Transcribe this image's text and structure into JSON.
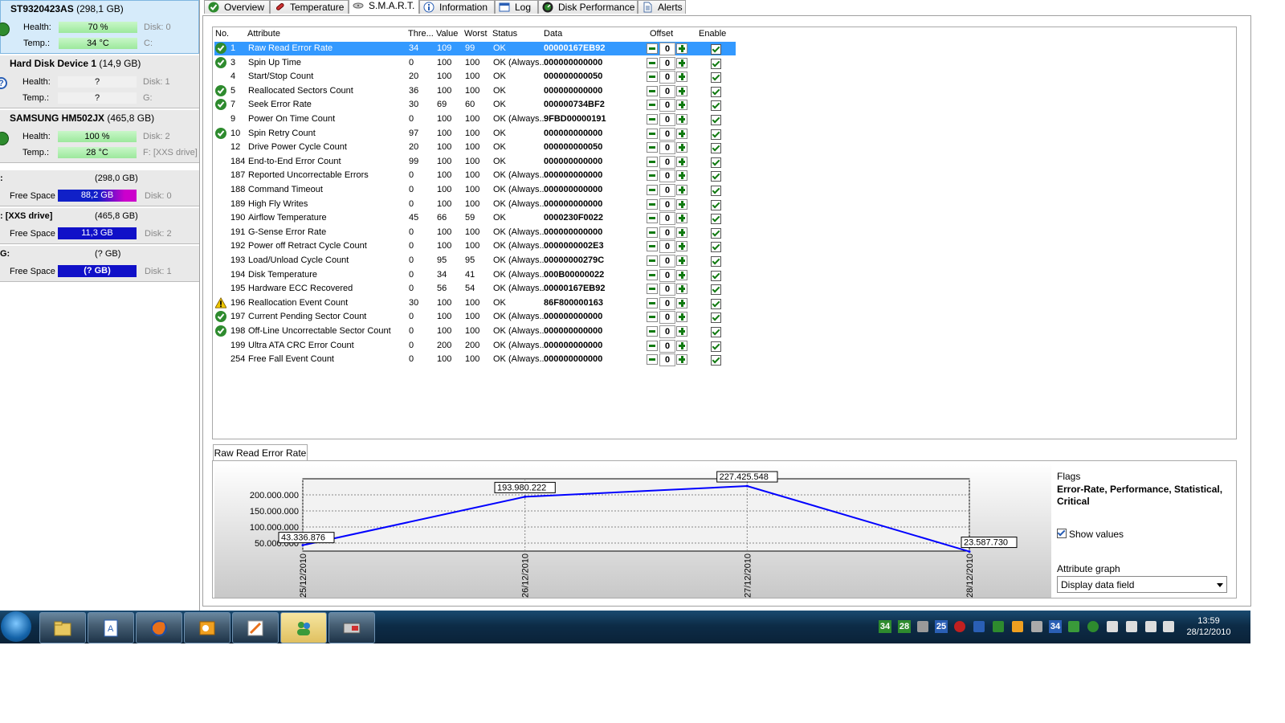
{
  "left_panel": {
    "disks": [
      {
        "name": "ST9320423AS",
        "size": "(298,1 GB)",
        "health_label": "Health:",
        "health": "70 %",
        "disk": "Disk: 0",
        "temp_label": "Temp.:",
        "temp": "34 °C",
        "drive": "C:"
      },
      {
        "name": "Hard Disk Device 1",
        "size": "(14,9 GB)",
        "health_label": "Health:",
        "health": "?",
        "disk": "Disk: 1",
        "temp_label": "Temp.:",
        "temp": "?",
        "drive": "G:"
      },
      {
        "name": "SAMSUNG HM502JX",
        "size": "(465,8 GB)",
        "health_label": "Health:",
        "health": "100 %",
        "disk": "Disk: 2",
        "temp_label": "Temp.:",
        "temp": "28 °C",
        "drive": "F: [XXS drive]"
      }
    ],
    "volumes": [
      {
        "name": ":",
        "size": "(298,0 GB)",
        "free_label": "Free Space",
        "free": "88,2 GB",
        "disk": "Disk: 0"
      },
      {
        "name": ": [XXS drive]",
        "size": "(465,8 GB)",
        "free_label": "Free Space",
        "free": "11,3 GB",
        "disk": "Disk: 2"
      },
      {
        "name": "G:",
        "size": "(? GB)",
        "free_label": "Free Space",
        "free": "(? GB)",
        "disk": "Disk: 1"
      }
    ]
  },
  "tabs": [
    "Overview",
    "Temperature",
    "S.M.A.R.T.",
    "Information",
    "Log",
    "Disk Performance",
    "Alerts"
  ],
  "grid": {
    "headers": {
      "no": "No.",
      "attribute": "Attribute",
      "threshold": "Thre...",
      "value": "Value",
      "worst": "Worst",
      "status": "Status",
      "data": "Data",
      "offset": "Offset",
      "enable": "Enable"
    },
    "rows": [
      {
        "icon": "ok",
        "no": "1",
        "attr": "Raw Read Error Rate",
        "thr": "34",
        "val": "109",
        "worst": "99",
        "status": "OK",
        "data": "00000167EB92",
        "offset": "0",
        "selected": true
      },
      {
        "icon": "ok",
        "no": "3",
        "attr": "Spin Up Time",
        "thr": "0",
        "val": "100",
        "worst": "100",
        "status": "OK (Always...",
        "data": "000000000000",
        "offset": "0"
      },
      {
        "icon": "",
        "no": "4",
        "attr": "Start/Stop Count",
        "thr": "20",
        "val": "100",
        "worst": "100",
        "status": "OK",
        "data": "000000000050",
        "offset": "0"
      },
      {
        "icon": "ok",
        "no": "5",
        "attr": "Reallocated Sectors Count",
        "thr": "36",
        "val": "100",
        "worst": "100",
        "status": "OK",
        "data": "000000000000",
        "offset": "0"
      },
      {
        "icon": "ok",
        "no": "7",
        "attr": "Seek Error Rate",
        "thr": "30",
        "val": "69",
        "worst": "60",
        "status": "OK",
        "data": "000000734BF2",
        "offset": "0"
      },
      {
        "icon": "",
        "no": "9",
        "attr": "Power On Time Count",
        "thr": "0",
        "val": "100",
        "worst": "100",
        "status": "OK (Always...",
        "data": "9FBD00000191",
        "offset": "0"
      },
      {
        "icon": "ok",
        "no": "10",
        "attr": "Spin Retry Count",
        "thr": "97",
        "val": "100",
        "worst": "100",
        "status": "OK",
        "data": "000000000000",
        "offset": "0"
      },
      {
        "icon": "",
        "no": "12",
        "attr": "Drive Power Cycle Count",
        "thr": "20",
        "val": "100",
        "worst": "100",
        "status": "OK",
        "data": "000000000050",
        "offset": "0"
      },
      {
        "icon": "",
        "no": "184",
        "attr": "End-to-End Error Count",
        "thr": "99",
        "val": "100",
        "worst": "100",
        "status": "OK",
        "data": "000000000000",
        "offset": "0"
      },
      {
        "icon": "",
        "no": "187",
        "attr": "Reported Uncorrectable Errors",
        "thr": "0",
        "val": "100",
        "worst": "100",
        "status": "OK (Always...",
        "data": "000000000000",
        "offset": "0"
      },
      {
        "icon": "",
        "no": "188",
        "attr": "Command Timeout",
        "thr": "0",
        "val": "100",
        "worst": "100",
        "status": "OK (Always...",
        "data": "000000000000",
        "offset": "0"
      },
      {
        "icon": "",
        "no": "189",
        "attr": "High Fly Writes",
        "thr": "0",
        "val": "100",
        "worst": "100",
        "status": "OK (Always...",
        "data": "000000000000",
        "offset": "0"
      },
      {
        "icon": "",
        "no": "190",
        "attr": "Airflow Temperature",
        "thr": "45",
        "val": "66",
        "worst": "59",
        "status": "OK",
        "data": "0000230F0022",
        "offset": "0"
      },
      {
        "icon": "",
        "no": "191",
        "attr": "G-Sense Error Rate",
        "thr": "0",
        "val": "100",
        "worst": "100",
        "status": "OK (Always...",
        "data": "000000000000",
        "offset": "0"
      },
      {
        "icon": "",
        "no": "192",
        "attr": "Power off Retract Cycle Count",
        "thr": "0",
        "val": "100",
        "worst": "100",
        "status": "OK (Always...",
        "data": "0000000002E3",
        "offset": "0"
      },
      {
        "icon": "",
        "no": "193",
        "attr": "Load/Unload Cycle Count",
        "thr": "0",
        "val": "95",
        "worst": "95",
        "status": "OK (Always...",
        "data": "00000000279C",
        "offset": "0"
      },
      {
        "icon": "",
        "no": "194",
        "attr": "Disk Temperature",
        "thr": "0",
        "val": "34",
        "worst": "41",
        "status": "OK (Always...",
        "data": "000B00000022",
        "offset": "0"
      },
      {
        "icon": "",
        "no": "195",
        "attr": "Hardware ECC Recovered",
        "thr": "0",
        "val": "56",
        "worst": "54",
        "status": "OK (Always...",
        "data": "00000167EB92",
        "offset": "0"
      },
      {
        "icon": "warn",
        "no": "196",
        "attr": "Reallocation Event Count",
        "thr": "30",
        "val": "100",
        "worst": "100",
        "status": "OK",
        "data": "86F800000163",
        "offset": "0"
      },
      {
        "icon": "ok",
        "no": "197",
        "attr": "Current Pending Sector Count",
        "thr": "0",
        "val": "100",
        "worst": "100",
        "status": "OK (Always...",
        "data": "000000000000",
        "offset": "0"
      },
      {
        "icon": "ok",
        "no": "198",
        "attr": "Off-Line Uncorrectable Sector Count",
        "thr": "0",
        "val": "100",
        "worst": "100",
        "status": "OK (Always...",
        "data": "000000000000",
        "offset": "0"
      },
      {
        "icon": "",
        "no": "199",
        "attr": "Ultra ATA CRC Error Count",
        "thr": "0",
        "val": "200",
        "worst": "200",
        "status": "OK (Always...",
        "data": "000000000000",
        "offset": "0"
      },
      {
        "icon": "",
        "no": "254",
        "attr": "Free Fall Event Count",
        "thr": "0",
        "val": "100",
        "worst": "100",
        "status": "OK (Always...",
        "data": "000000000000",
        "offset": "0"
      }
    ]
  },
  "graph": {
    "tab_label": "Raw Read Error Rate",
    "flags_label": "Flags",
    "flags_value": "Error-Rate, Performance, Statistical, Critical",
    "show_values_label": "Show values",
    "attr_graph_label": "Attribute graph",
    "attr_graph_value": "Display data field"
  },
  "chart_data": {
    "type": "line",
    "x": [
      "25/12/2010",
      "26/12/2010",
      "27/12/2010",
      "28/12/2010"
    ],
    "series": [
      {
        "values": [
          43336876,
          193980222,
          227425548,
          23587730
        ]
      }
    ],
    "value_labels": [
      "43.336.876",
      "193.980.222",
      "227.425.548",
      "23.587.730"
    ],
    "y_ticks": [
      50000000,
      100000000,
      150000000,
      200000000
    ],
    "y_tick_labels": [
      "50.000.000",
      "100.000.000",
      "150.000.000",
      "200.000.000"
    ],
    "ylim": [
      25000000,
      250000000
    ],
    "grid": true,
    "color": "#0000ff"
  },
  "taskbar": {
    "tray_numbers": [
      "34",
      "28",
      "25",
      "34"
    ],
    "time": "13:59",
    "date": "28/12/2010"
  },
  "colors": {
    "selection": "#3399ff",
    "ok": "#2e8b2e",
    "free_bar_0": "#cc00cc",
    "free_bar_1": "#0000cc"
  }
}
